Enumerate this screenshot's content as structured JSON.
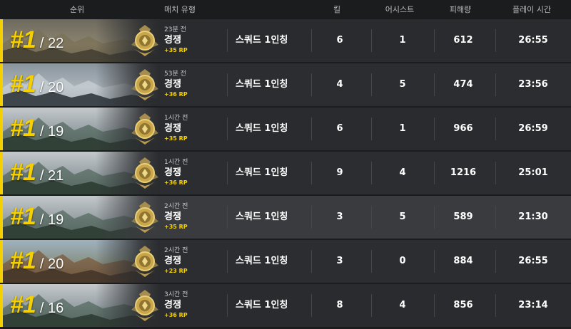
{
  "header": {
    "rank": "순위",
    "match_type": "매치 유형",
    "kills": "킬",
    "assists": "어시스트",
    "damage": "피해량",
    "playtime": "플레이 시간"
  },
  "colors": {
    "accent": "#f5d000",
    "row_bg": "#2a2b2e",
    "row_highlight": "#3a3b3e"
  },
  "matches": [
    {
      "rank": "#1",
      "total": "/ 22",
      "ago": "23분 전",
      "mode": "경쟁",
      "rp": "+35 RP",
      "type": "스쿼드 1인칭",
      "kills": "6",
      "assists": "1",
      "damage": "612",
      "time": "26:55",
      "map": "desert-town"
    },
    {
      "rank": "#1",
      "total": "/ 20",
      "ago": "53분 전",
      "mode": "경쟁",
      "rp": "+36 RP",
      "type": "스쿼드 1인칭",
      "kills": "4",
      "assists": "5",
      "damage": "474",
      "time": "23:56",
      "map": "snow-city"
    },
    {
      "rank": "#1",
      "total": "/ 19",
      "ago": "1시간 전",
      "mode": "경쟁",
      "rp": "+35 RP",
      "type": "스쿼드 1인칭",
      "kills": "6",
      "assists": "1",
      "damage": "966",
      "time": "26:59",
      "map": "karst-mountains"
    },
    {
      "rank": "#1",
      "total": "/ 21",
      "ago": "1시간 전",
      "mode": "경쟁",
      "rp": "+36 RP",
      "type": "스쿼드 1인칭",
      "kills": "9",
      "assists": "4",
      "damage": "1216",
      "time": "25:01",
      "map": "karst-mountains"
    },
    {
      "rank": "#1",
      "total": "/ 19",
      "ago": "2시간 전",
      "mode": "경쟁",
      "rp": "+35 RP",
      "type": "스쿼드 1인칭",
      "kills": "3",
      "assists": "5",
      "damage": "589",
      "time": "21:30",
      "map": "karst-mountains"
    },
    {
      "rank": "#1",
      "total": "/ 20",
      "ago": "2시간 전",
      "mode": "경쟁",
      "rp": "+23 RP",
      "type": "스쿼드 1인칭",
      "kills": "3",
      "assists": "0",
      "damage": "884",
      "time": "26:55",
      "map": "temple-village"
    },
    {
      "rank": "#1",
      "total": "/ 16",
      "ago": "3시간 전",
      "mode": "경쟁",
      "rp": "+36 RP",
      "type": "스쿼드 1인칭",
      "kills": "8",
      "assists": "4",
      "damage": "856",
      "time": "23:14",
      "map": "karst-mountains"
    }
  ]
}
